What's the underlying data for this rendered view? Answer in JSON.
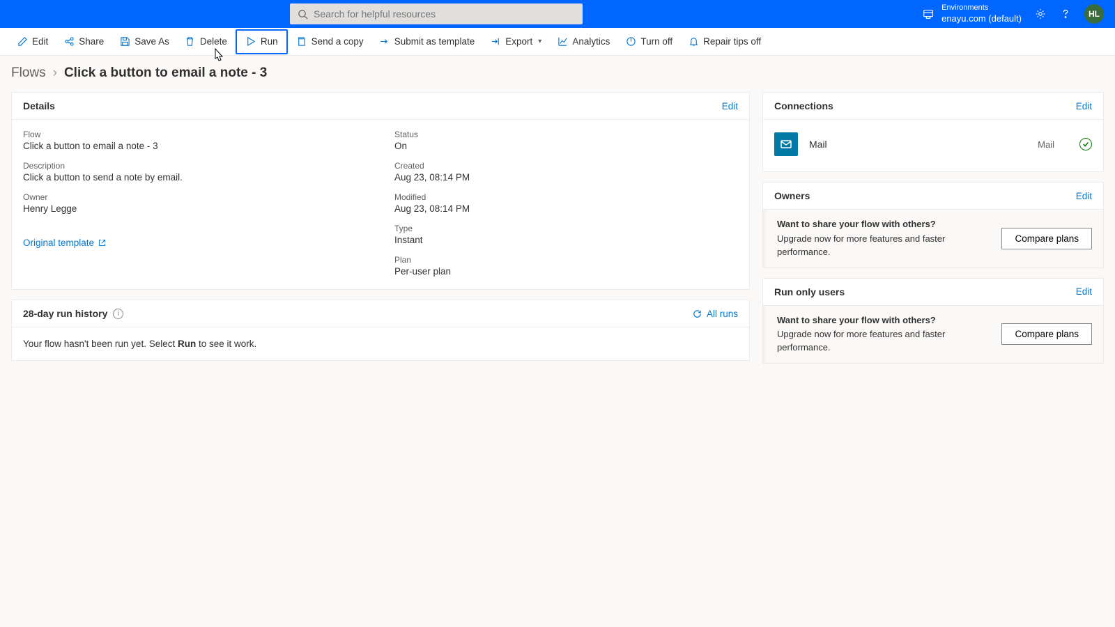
{
  "header": {
    "search_placeholder": "Search for helpful resources",
    "env_label": "Environments",
    "env_name": "enayu.com (default)",
    "avatar_initials": "HL"
  },
  "commands": {
    "edit": "Edit",
    "share": "Share",
    "saveas": "Save As",
    "delete": "Delete",
    "run": "Run",
    "sendcopy": "Send a copy",
    "submit": "Submit as template",
    "export": "Export",
    "analytics": "Analytics",
    "turnoff": "Turn off",
    "repair": "Repair tips off"
  },
  "breadcrumb": {
    "root": "Flows",
    "current": "Click a button to email a note - 3"
  },
  "details": {
    "title": "Details",
    "edit": "Edit",
    "flow_label": "Flow",
    "flow_value": "Click a button to email a note - 3",
    "desc_label": "Description",
    "desc_value": "Click a button to send a note by email.",
    "owner_label": "Owner",
    "owner_value": "Henry Legge",
    "status_label": "Status",
    "status_value": "On",
    "created_label": "Created",
    "created_value": "Aug 23, 08:14 PM",
    "modified_label": "Modified",
    "modified_value": "Aug 23, 08:14 PM",
    "type_label": "Type",
    "type_value": "Instant",
    "plan_label": "Plan",
    "plan_value": "Per-user plan",
    "template_link": "Original template"
  },
  "history": {
    "title": "28-day run history",
    "all_runs": "All runs",
    "empty_pre": "Your flow hasn't been run yet. Select ",
    "empty_bold": "Run",
    "empty_post": " to see it work."
  },
  "connections": {
    "title": "Connections",
    "edit": "Edit",
    "item_name": "Mail",
    "item_type": "Mail"
  },
  "owners": {
    "title": "Owners",
    "edit": "Edit"
  },
  "runonly": {
    "title": "Run only users",
    "edit": "Edit"
  },
  "upgrade": {
    "q": "Want to share your flow with others?",
    "desc": "Upgrade now for more features and faster performance.",
    "btn": "Compare plans"
  }
}
